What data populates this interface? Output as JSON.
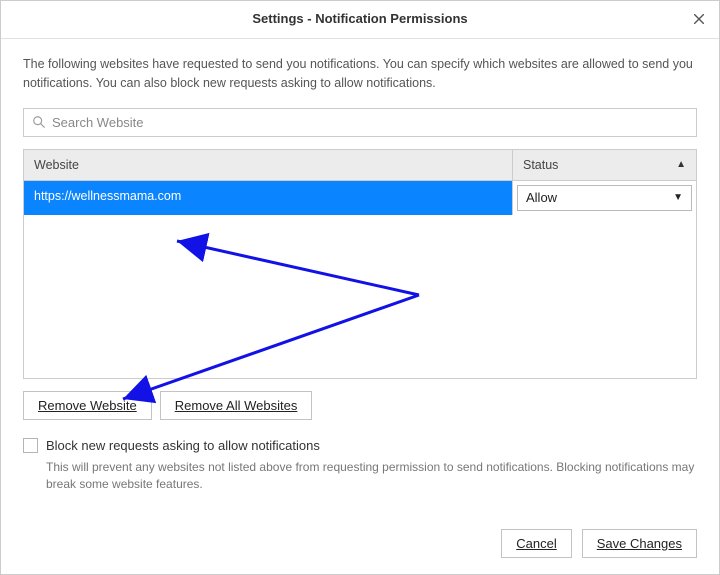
{
  "dialog": {
    "title": "Settings - Notification Permissions"
  },
  "description": "The following websites have requested to send you notifications. You can specify which websites are allowed to send you notifications. You can also block new requests asking to allow notifications.",
  "search": {
    "placeholder": "Search Website"
  },
  "table": {
    "headers": {
      "website": "Website",
      "status": "Status"
    },
    "rows": [
      {
        "website": "https://wellnessmama.com",
        "status": "Allow",
        "selected": true
      }
    ]
  },
  "buttons": {
    "remove_website": "Remove Website",
    "remove_all": "Remove All Websites",
    "cancel": "Cancel",
    "save": "Save Changes"
  },
  "block": {
    "label": "Block new requests asking to allow notifications",
    "note": "This will prevent any websites not listed above from requesting permission to send notifications. Blocking notifications may break some website features.",
    "checked": false
  }
}
